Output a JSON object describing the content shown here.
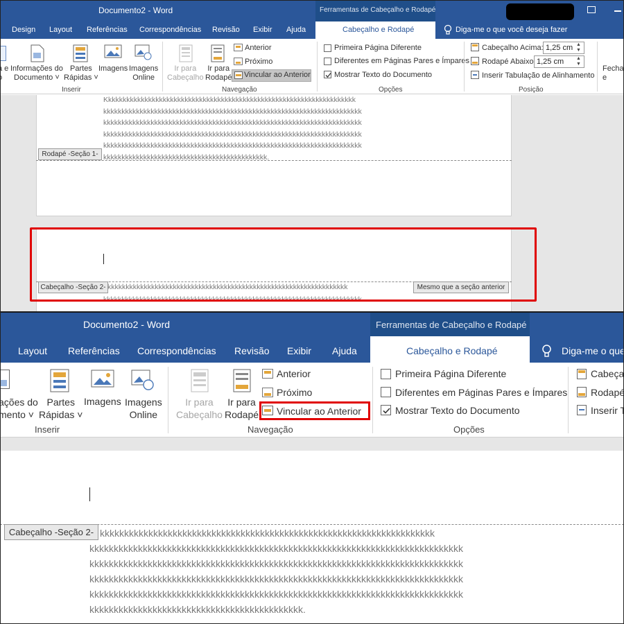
{
  "top": {
    "title": "Documento2  -  Word",
    "context_title": "Ferramentas de Cabeçalho e Rodapé",
    "tabs": [
      "Design",
      "Layout",
      "Referências",
      "Correspondências",
      "Revisão",
      "Exibir",
      "Ajuda"
    ],
    "active_tab": "Cabeçalho e Rodapé",
    "tell_me": "Diga-me o que você deseja fazer",
    "inserir": {
      "info_label": "a e\no",
      "doc_info": "Informações do\nDocumento ˅",
      "quick_parts": "Partes\nRápidas ˅",
      "images": "Imagens",
      "online_images": "Imagens\nOnline",
      "group": "Inserir"
    },
    "nav": {
      "goto_header": "Ir para\nCabeçalho",
      "goto_footer": "Ir para\nRodapé",
      "previous": "Anterior",
      "next": "Próximo",
      "link_previous": "Vincular ao Anterior",
      "group": "Navegação"
    },
    "options": {
      "first_page": "Primeira Página Diferente",
      "odd_even": "Diferentes em Páginas Pares e Ímpares",
      "show_text": "Mostrar Texto do Documento",
      "group": "Opções"
    },
    "position": {
      "header_top": "Cabeçalho Acima:",
      "header_top_value": "1,25 cm",
      "footer_bottom": "Rodapé Abaixo:",
      "footer_bottom_value": "1,25 cm",
      "align_tab": "Inserir Tabulação de Alinhamento",
      "group": "Posição"
    },
    "close": "Fecha\ne",
    "doc": {
      "lines": [
        "Kkkkkkkkkkkkkkkkkkkkkkkkkkkkkkkkkkkkkkkkkkkkkkkkkkkkkkkkkkkkkkkkkkkkk",
        "kkkkkkkkkkkkkkkkkkkkkkkkkkkkkkkkkkkkkkkkkkkkkkkkkkkkkkkkkkkkkkkkkkkkkkk",
        "kkkkkkkkkkkkkkkkkkkkkkkkkkkkkkkkkkkkkkkkkkkkkkkkkkkkkkkkkkkkkkkkkkkkkkk",
        "kkkkkkkkkkkkkkkkkkkkkkkkkkkkkkkkkkkkkkkkkkkkkkkkkkkkkkkkkkkkkkkkkkkkkkk",
        "kkkkkkkkkkkkkkkkkkkkkkkkkkkkkkkkkkkkkkkkkkkkkkkkkkkkkkkkkkkkkkkkkkkkkkk",
        "kkkkkkkkkkkkkkkkkkkkkkkkkkkkkkkkkkkkkkkkkkkkk."
      ],
      "footer_tag": "Rodapé -Seção 1-",
      "header_tag": "Cabeçalho -Seção 2-",
      "same_as_previous": "Mesmo que a seção anterior",
      "sec2_line1": "kkkkkkkkkkkkkkkkkkkkkkkkkkkkkkkkkkkkkkkkkkkkkkkkkkkkkkkkkkkkkkkkkk",
      "sec2_line2": "kkkkkkkkkkkkkkkkkkkkkkkkkkkkkkkkkkkkkkkkkkkkkkkkkkkkkkkkkkkkkkkkkkkkkkk"
    }
  },
  "bottom": {
    "title": "Documento2  -  Word",
    "context_title": "Ferramentas de Cabeçalho e Rodapé",
    "tabs": [
      "Layout",
      "Referências",
      "Correspondências",
      "Revisão",
      "Exibir",
      "Ajuda"
    ],
    "active_tab": "Cabeçalho e Rodapé",
    "tell_me": "Diga-me o que",
    "inserir": {
      "info_label": "ações do\nmento ˅",
      "quick_parts": "Partes\nRápidas ˅",
      "images": "Imagens",
      "online_images": "Imagens\nOnline",
      "group": "Inserir"
    },
    "nav": {
      "goto_header": "Ir para\nCabeçalho",
      "goto_footer": "Ir para\nRodapé",
      "previous": "Anterior",
      "next": "Próximo",
      "link_previous": "Vincular ao Anterior",
      "group": "Navegação"
    },
    "options": {
      "first_page": "Primeira Página Diferente",
      "odd_even": "Diferentes em Páginas Pares e Ímpares",
      "show_text": "Mostrar Texto do Documento",
      "group": "Opções"
    },
    "position": {
      "header_top": "Cabeça",
      "footer_bottom": "Rodapé",
      "align_tab": "Inserir T"
    },
    "doc": {
      "header_tag": "Cabeçalho -Seção 2-",
      "lines": [
        "kkkkkkkkkkkkkkkkkkkkkkkkkkkkkkkkkkkkkkkkkkkkkkkkkkkkkkkkkkkkkkkkkkkkk",
        "kkkkkkkkkkkkkkkkkkkkkkkkkkkkkkkkkkkkkkkkkkkkkkkkkkkkkkkkkkkkkkkkkkkkkkkkkkkkk",
        "kkkkkkkkkkkkkkkkkkkkkkkkkkkkkkkkkkkkkkkkkkkkkkkkkkkkkkkkkkkkkkkkkkkkkkkkkkkkk",
        "kkkkkkkkkkkkkkkkkkkkkkkkkkkkkkkkkkkkkkkkkkkkkkkkkkkkkkkkkkkkkkkkkkkkkkkkkkkkk",
        "kkkkkkkkkkkkkkkkkkkkkkkkkkkkkkkkkkkkkkkkkkkkkkkkkkkkkkkkkkkkkkkkkkkkkkkkkkkkk",
        "kkkkkkkkkkkkkkkkkkkkkkkkkkkkkkkkkkkkkkkkkkkk."
      ]
    }
  },
  "colors": {
    "title_bar": "#2b579a",
    "context_bar": "#1f4e89",
    "highlight": "#e00000",
    "doc_text": "#7a7a7a"
  }
}
